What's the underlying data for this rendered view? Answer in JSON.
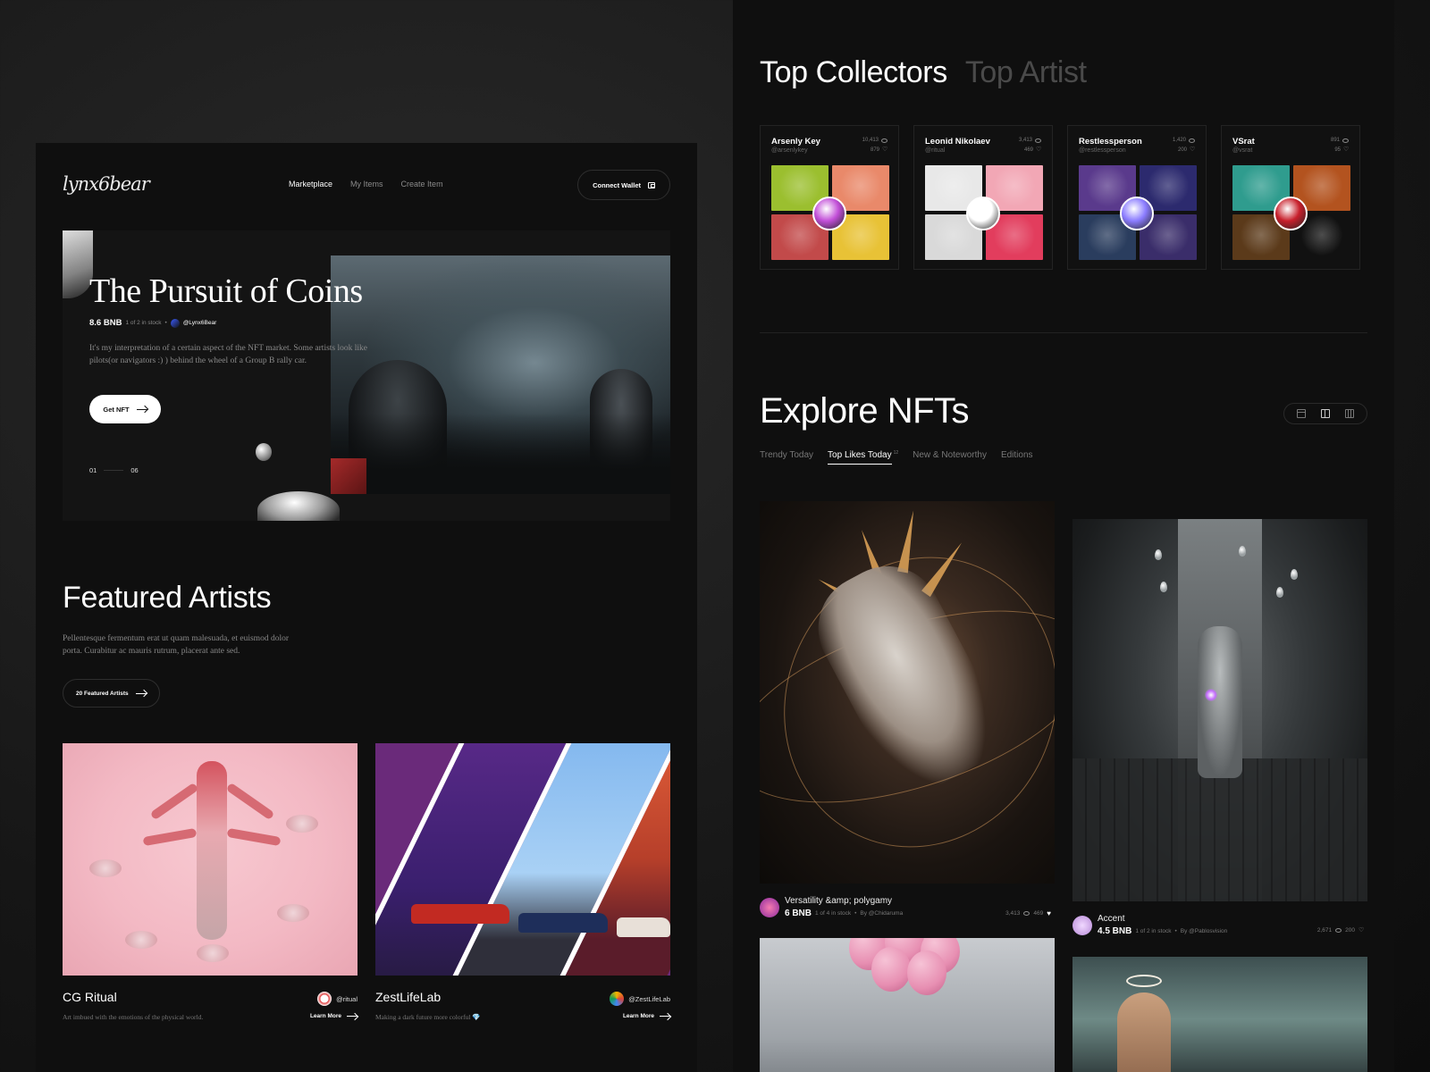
{
  "brand": {
    "logo_text": "lynx6bear"
  },
  "nav": {
    "items": [
      {
        "label": "Marketplace",
        "active": true
      },
      {
        "label": "My Items",
        "active": false
      },
      {
        "label": "Create Item",
        "active": false
      }
    ],
    "connect_label": "Connect Wallet"
  },
  "hero": {
    "title": "The Pursuit of Coins",
    "price": "8.6 BNB",
    "stock": "1 of 2 in stock",
    "author": "@Lynx6Bear",
    "description": "It's my interpretation of a certain aspect of the NFT market. Some artists look like pilots(or navigators :) ) behind the wheel of a Group B rally car.",
    "cta": "Get NFT",
    "pager_current": "01",
    "pager_total": "06"
  },
  "featured": {
    "title": "Featured Artists",
    "description": "Pellentesque fermentum erat ut quam malesuada, et euismod dolor porta. Curabitur ac mauris rutrum, placerat ante sed.",
    "button": "20 Featured Artists",
    "artists": [
      {
        "name": "CG Ritual",
        "handle": "@ritual",
        "subtitle": "Art imbued with the emotions of the physical world.",
        "learn": "Learn More"
      },
      {
        "name": "ZestLifeLab",
        "handle": "@ZestLifeLab",
        "subtitle": "Making a dark future more colorful 💎",
        "learn": "Learn More"
      }
    ]
  },
  "top_tabs": {
    "active": "Top Collectors",
    "inactive": "Top Artist"
  },
  "collectors": [
    {
      "name": "Arsenly Key",
      "handle": "@arsenlykey",
      "views": "10,413",
      "likes": "879",
      "colors": [
        "#9bbf2f",
        "#e9896a",
        "#c24a4a",
        "#e8c236"
      ],
      "avatar": "#c24fd8"
    },
    {
      "name": "Leonid Nikolaev",
      "handle": "@ritual",
      "views": "3,413",
      "likes": "469",
      "colors": [
        "#e8e8e8",
        "#f2a7b5",
        "#d9d9d9",
        "#e23d5d"
      ],
      "avatar": "#ffffff"
    },
    {
      "name": "Restlessperson",
      "handle": "@restlessperson",
      "views": "1,420",
      "likes": "200",
      "colors": [
        "#5a3a8c",
        "#2c2a6e",
        "#2a3d5e",
        "#3a2d6a"
      ],
      "avatar": "#8b7cff"
    },
    {
      "name": "VSrat",
      "handle": "@vsrat",
      "views": "891",
      "likes": "95",
      "colors": [
        "#2f9c8e",
        "#b3531f",
        "#5b3a1a",
        "#111111"
      ],
      "avatar": "#c8202c"
    }
  ],
  "explore": {
    "title": "Explore NFTs",
    "tabs": [
      {
        "label": "Trendy Today",
        "active": false
      },
      {
        "label": "Top Likes Today",
        "active": true,
        "count": "12"
      },
      {
        "label": "New & Noteworthy",
        "active": false
      },
      {
        "label": "Editions",
        "active": false
      }
    ],
    "nfts": [
      {
        "name": "Versatility &amp; polygamy",
        "price": "6 BNB",
        "stock": "1 of 4 in stock",
        "by": "By @Chidaruma",
        "views": "3,413",
        "likes": "469"
      },
      {
        "name": "Accent",
        "price": "4.5 BNB",
        "stock": "1 of 2 in stock",
        "by": "By @Pablosvision",
        "views": "2,671",
        "likes": "200"
      }
    ]
  },
  "colors": {
    "bg": "#0f0f0f",
    "accent": "#ffffff",
    "muted": "#777777"
  }
}
